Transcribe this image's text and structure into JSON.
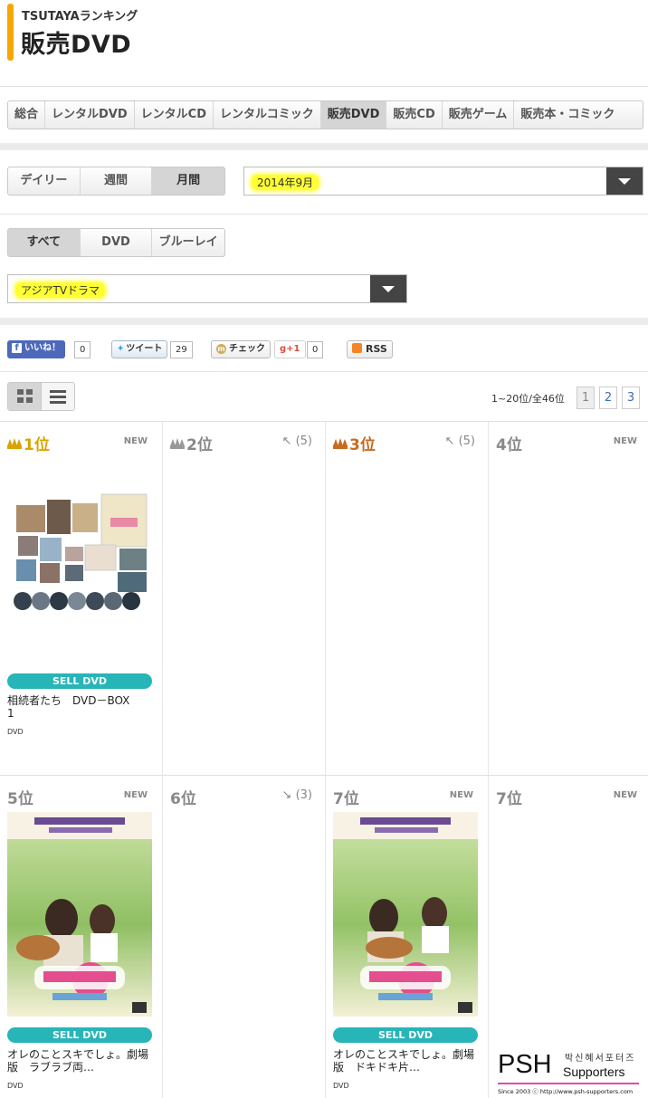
{
  "header": {
    "supertitle": "TSUTAYAランキング",
    "title": "販売DVD"
  },
  "category_tabs": [
    {
      "label": "総合",
      "active": false
    },
    {
      "label": "レンタルDVD",
      "active": false
    },
    {
      "label": "レンタルCD",
      "active": false
    },
    {
      "label": "レンタルコミック",
      "active": false
    },
    {
      "label": "販売DVD",
      "active": true
    },
    {
      "label": "販売CD",
      "active": false
    },
    {
      "label": "販売ゲーム",
      "active": false
    },
    {
      "label": "販売本・コミック",
      "active": false
    }
  ],
  "period_tabs": [
    {
      "label": "デイリー",
      "active": false
    },
    {
      "label": "週間",
      "active": false
    },
    {
      "label": "月間",
      "active": true
    }
  ],
  "period_select": {
    "value": "2014年9月"
  },
  "format_tabs": [
    {
      "label": "すべて",
      "active": true
    },
    {
      "label": "DVD",
      "active": false
    },
    {
      "label": "ブルーレイ",
      "active": false
    }
  ],
  "genre_select": {
    "value": "アジアTVドラマ"
  },
  "social": {
    "like_label": "いいね！",
    "like_count": "0",
    "tweet_label": "ツイート",
    "tweet_count": "29",
    "check_label": "チェック",
    "gplus_label": "g+1",
    "gplus_count": "0",
    "rss_label": "RSS"
  },
  "pagination": {
    "info": "1~20位/全46位",
    "pages": [
      "1",
      "2",
      "3"
    ],
    "current": "1"
  },
  "colors": {
    "accent": "#f5a800",
    "gold": "#d9a400",
    "silver": "#999999",
    "bronze": "#c96a1e",
    "sell_badge": "#27b5b8"
  },
  "rankings": [
    {
      "rank": "1位",
      "crown": "gold",
      "status": "NEW",
      "badge": "SELL DVD",
      "title": "相続者たち　DVD－BOX\n1",
      "format": "DVD",
      "has_cover": true
    },
    {
      "rank": "2位",
      "crown": "silver",
      "status": "↖ (5)",
      "badge": "",
      "title": "",
      "format": "",
      "has_cover": false
    },
    {
      "rank": "3位",
      "crown": "bronze",
      "status": "↖ (5)",
      "badge": "",
      "title": "",
      "format": "",
      "has_cover": false
    },
    {
      "rank": "4位",
      "crown": "",
      "status": "NEW",
      "badge": "",
      "title": "",
      "format": "",
      "has_cover": false
    },
    {
      "rank": "5位",
      "crown": "",
      "status": "NEW",
      "badge": "SELL DVD",
      "title": "オレのことスキでしょ。劇場版　ラブラブ両…",
      "format": "DVD",
      "has_cover": true
    },
    {
      "rank": "6位",
      "crown": "",
      "status": "↘ (3)",
      "badge": "",
      "title": "",
      "format": "",
      "has_cover": false
    },
    {
      "rank": "7位",
      "crown": "",
      "status": "NEW",
      "badge": "SELL DVD",
      "title": "オレのことスキでしょ。劇場版　ドキドキ片…",
      "format": "DVD",
      "has_cover": true
    },
    {
      "rank": "7位",
      "crown": "",
      "status": "NEW",
      "badge": "",
      "title": "",
      "format": "",
      "has_cover": false
    }
  ],
  "watermark": {
    "logo": "PSH",
    "name": "Supporters",
    "korean": "박신혜서포터즈",
    "since": "Since 2003 ⓒ http://www.psh-supporters.com"
  }
}
